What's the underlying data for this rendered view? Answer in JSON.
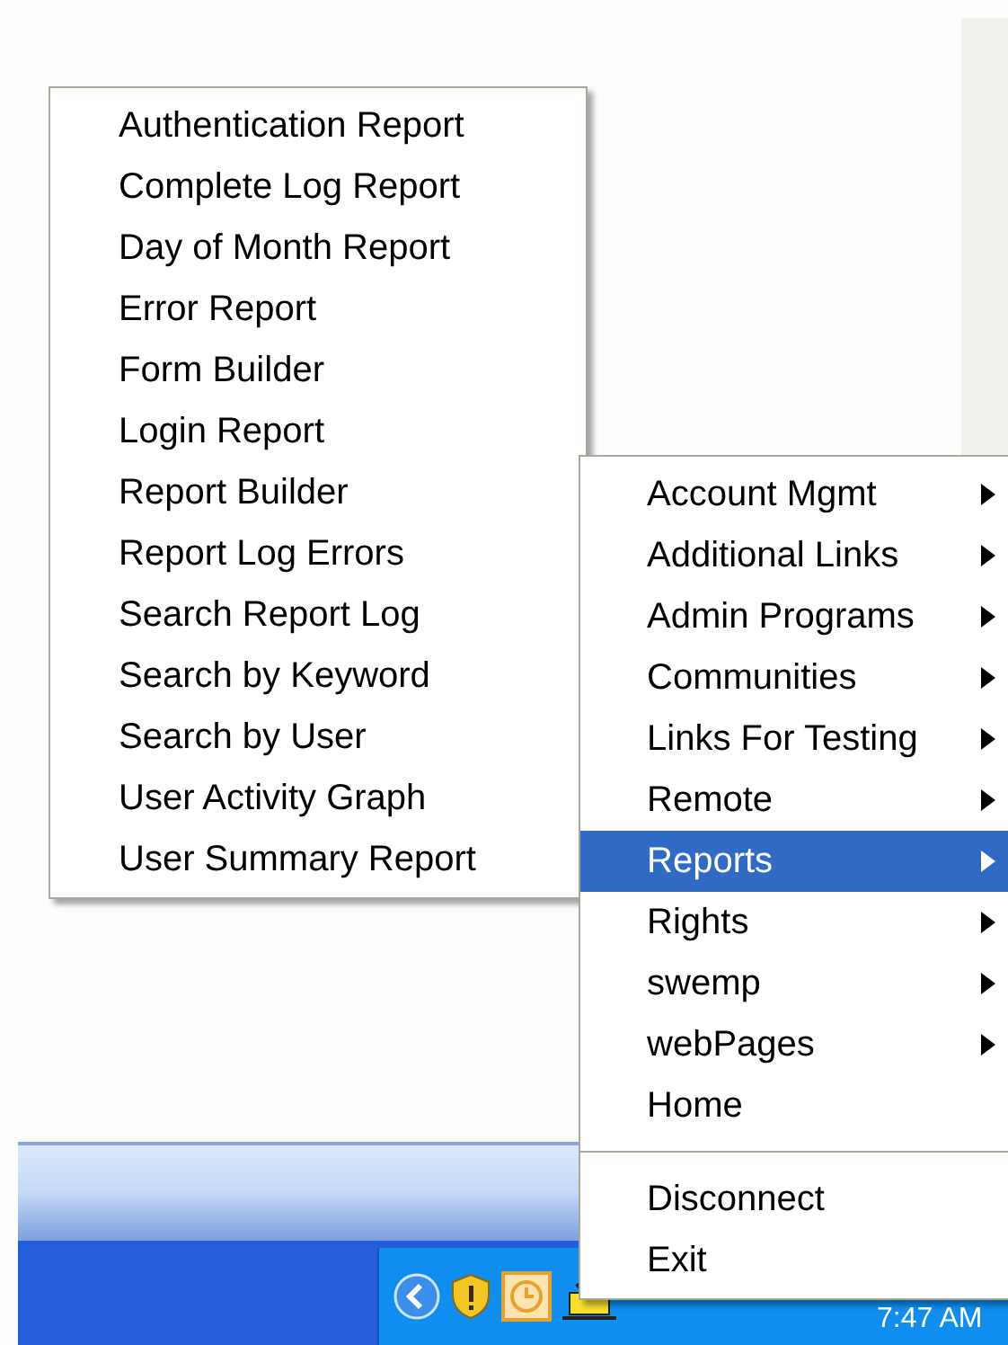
{
  "submenu": {
    "items": [
      {
        "label": "Authentication Report"
      },
      {
        "label": "Complete Log Report"
      },
      {
        "label": "Day of Month Report"
      },
      {
        "label": "Error Report"
      },
      {
        "label": "Form Builder"
      },
      {
        "label": "Login Report"
      },
      {
        "label": "Report Builder"
      },
      {
        "label": "Report Log Errors"
      },
      {
        "label": "Search Report Log"
      },
      {
        "label": "Search by Keyword"
      },
      {
        "label": "Search by User"
      },
      {
        "label": "User Activity Graph"
      },
      {
        "label": "User Summary Report"
      }
    ]
  },
  "menu": {
    "items": [
      {
        "kind": "submenu",
        "label": "Account Mgmt",
        "selected": false
      },
      {
        "kind": "submenu",
        "label": "Additional Links",
        "selected": false
      },
      {
        "kind": "submenu",
        "label": "Admin Programs",
        "selected": false
      },
      {
        "kind": "submenu",
        "label": "Communities",
        "selected": false
      },
      {
        "kind": "submenu",
        "label": "Links For Testing",
        "selected": false
      },
      {
        "kind": "submenu",
        "label": "Remote",
        "selected": false
      },
      {
        "kind": "submenu",
        "label": "Reports",
        "selected": true
      },
      {
        "kind": "submenu",
        "label": "Rights",
        "selected": false
      },
      {
        "kind": "submenu",
        "label": "swemp",
        "selected": false
      },
      {
        "kind": "submenu",
        "label": "webPages",
        "selected": false
      },
      {
        "kind": "command",
        "label": "Home",
        "selected": false
      },
      {
        "kind": "separator"
      },
      {
        "kind": "command",
        "label": "Disconnect",
        "selected": false
      },
      {
        "kind": "command",
        "label": "Exit",
        "selected": false
      }
    ]
  },
  "taskbar": {
    "clock": "7:47 AM"
  }
}
